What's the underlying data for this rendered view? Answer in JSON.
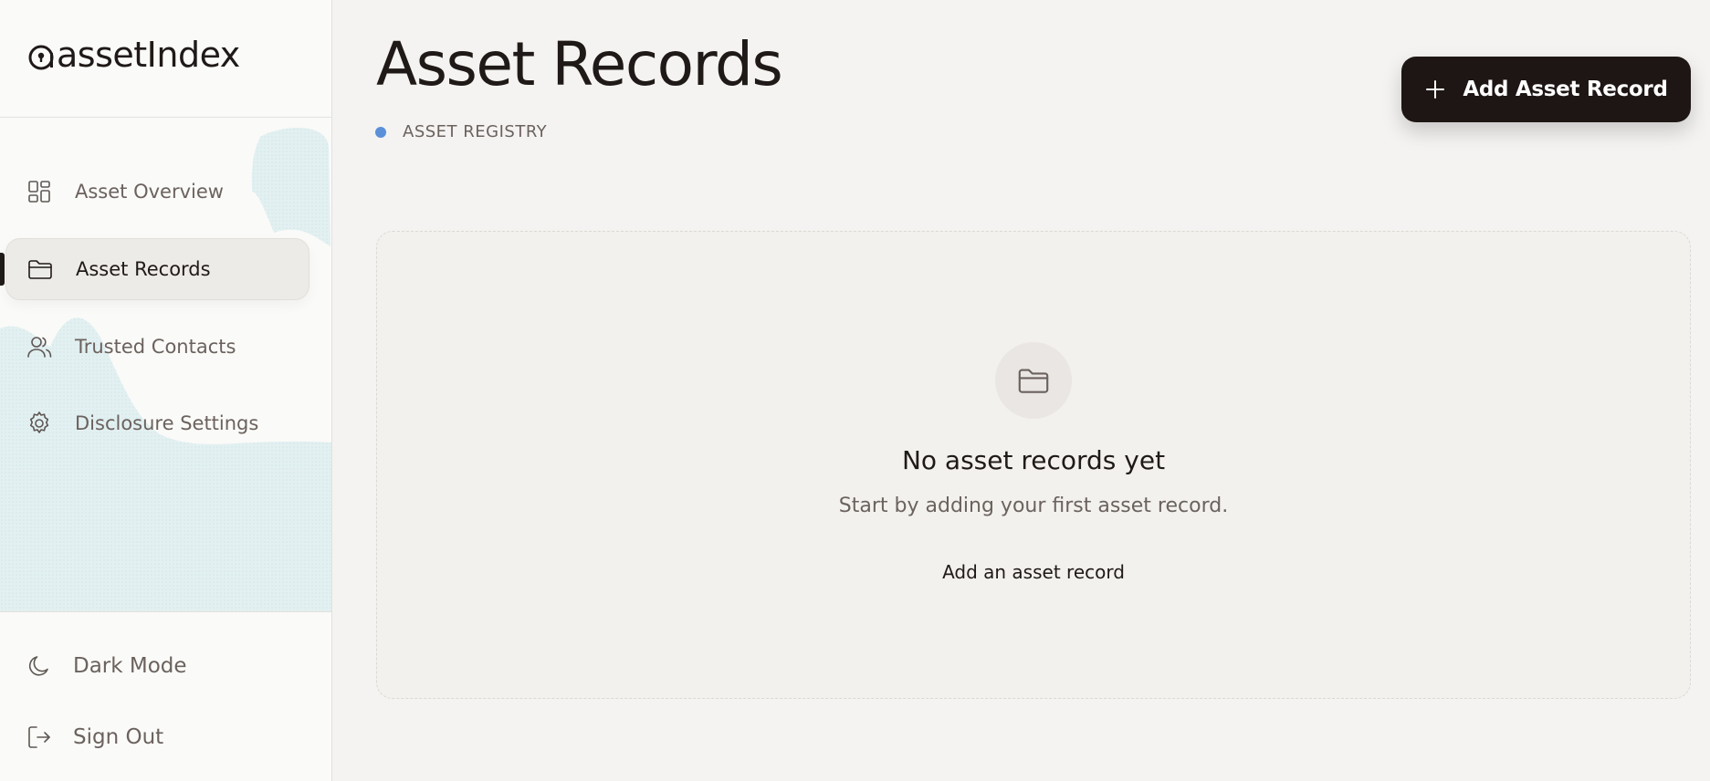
{
  "app": {
    "logo_text": "assetIndex"
  },
  "sidebar": {
    "items": [
      {
        "label": "Asset Overview",
        "icon": "grid-icon"
      },
      {
        "label": "Asset Records",
        "icon": "folder-icon",
        "active": true
      },
      {
        "label": "Trusted Contacts",
        "icon": "users-icon"
      },
      {
        "label": "Disclosure Settings",
        "icon": "gear-icon"
      }
    ],
    "footer": [
      {
        "label": "Dark Mode",
        "icon": "moon-icon"
      },
      {
        "label": "Sign Out",
        "icon": "sign-out-icon"
      }
    ]
  },
  "header": {
    "title": "Asset Records",
    "section_label": "ASSET REGISTRY",
    "add_button_label": "Add Asset Record"
  },
  "empty_state": {
    "icon": "folder-icon",
    "title": "No asset records yet",
    "subtitle": "Start by adding your first asset record.",
    "link_label": "Add an asset record"
  },
  "colors": {
    "accent_dot": "#5b8fd9",
    "primary_button": "#1e1614",
    "background": "#f4f3f1",
    "sidebar_background": "#fafaf8"
  }
}
